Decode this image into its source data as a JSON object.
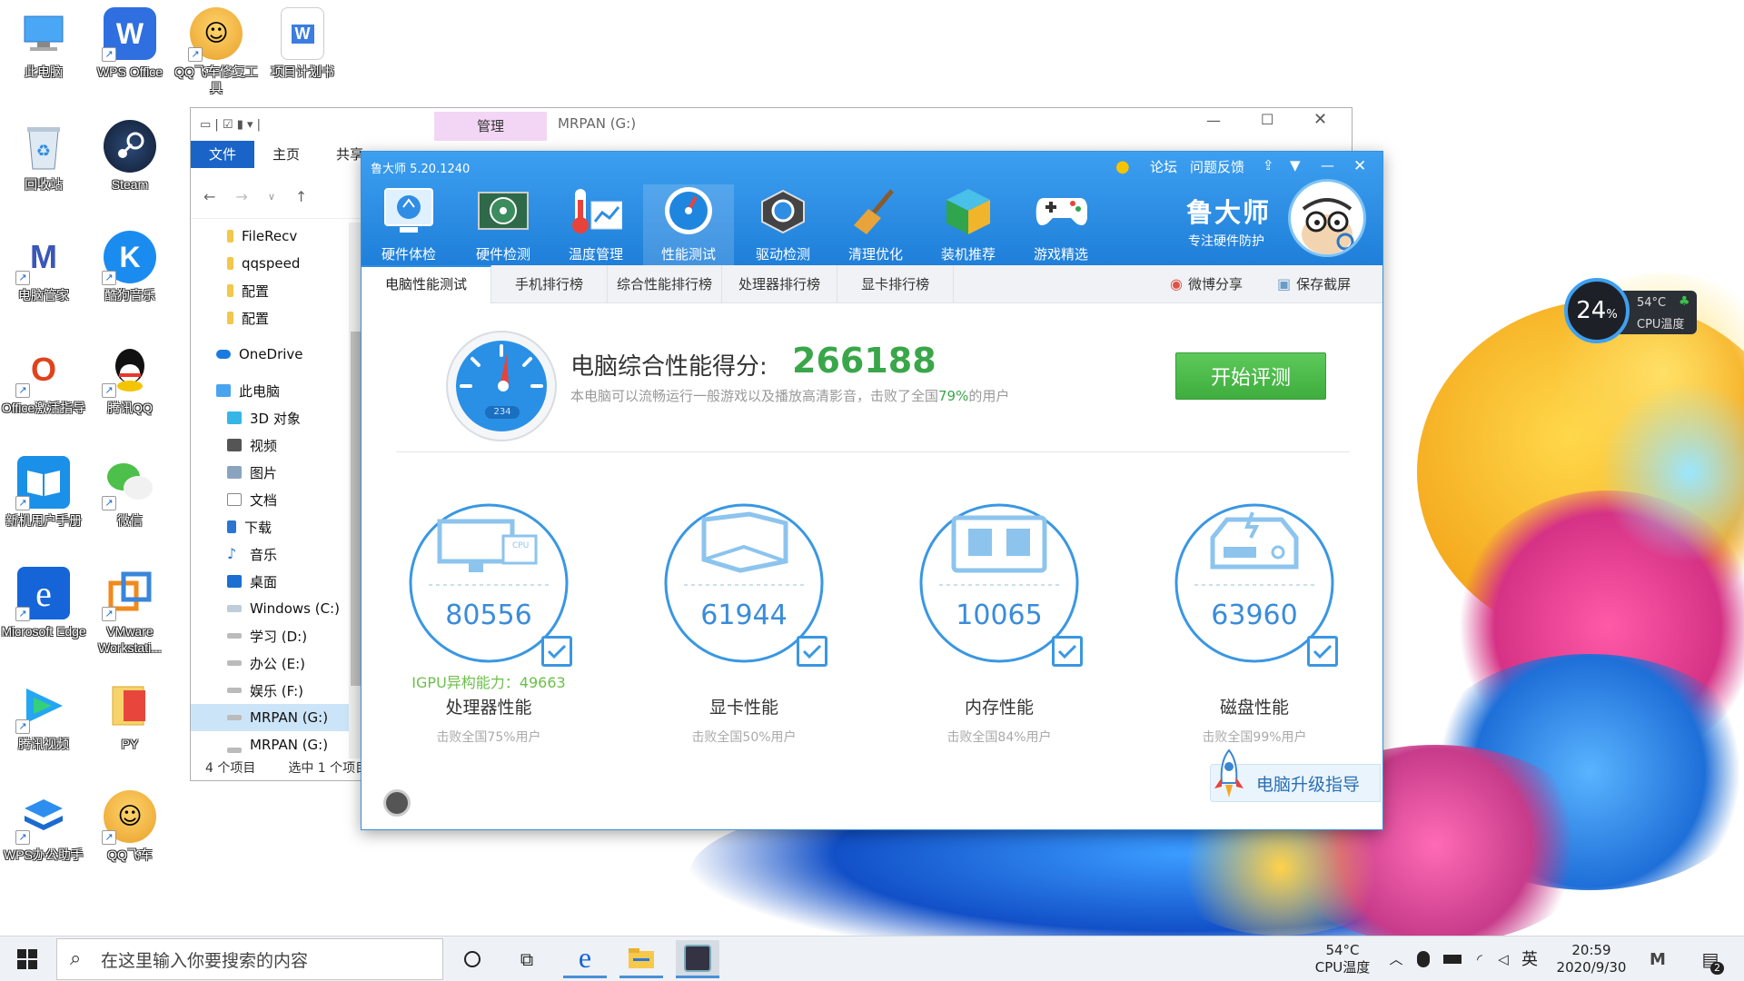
{
  "desktop": {
    "icons": [
      {
        "label": "此电脑",
        "icon": "computer-icon"
      },
      {
        "label": "WPS Office",
        "icon": "wps-icon"
      },
      {
        "label": "QQ飞车修复工具",
        "icon": "qq-speed-icon"
      },
      {
        "label": "项目计划书",
        "icon": "word-doc-icon"
      },
      {
        "label": "回收站",
        "icon": "recycle-bin-icon"
      },
      {
        "label": "Steam",
        "icon": "steam-icon"
      },
      {
        "label": "电脑管家",
        "icon": "pc-manager-icon"
      },
      {
        "label": "酷狗音乐",
        "icon": "kugou-icon"
      },
      {
        "label": "Office激活指导",
        "icon": "office-icon"
      },
      {
        "label": "腾讯QQ",
        "icon": "qq-icon"
      },
      {
        "label": "新机用户手册",
        "icon": "manual-icon"
      },
      {
        "label": "微信",
        "icon": "wechat-icon"
      },
      {
        "label": "Microsoft Edge",
        "icon": "edge-icon"
      },
      {
        "label": "VMware Workstati...",
        "icon": "vmware-icon"
      },
      {
        "label": "腾讯视频",
        "icon": "tencent-video-icon"
      },
      {
        "label": "PY",
        "icon": "folder-icon"
      },
      {
        "label": "WPS办公助手",
        "icon": "wps-assistant-icon"
      },
      {
        "label": "QQ飞车",
        "icon": "qq-speed-icon"
      }
    ]
  },
  "explorer": {
    "context_tab": "管理",
    "drive_title": "MRPAN (G:)",
    "ribbon_tabs": [
      "文件",
      "主页",
      "共享"
    ],
    "nav_items": [
      {
        "label": "FileRecv",
        "icon": "folder-icon"
      },
      {
        "label": "qqspeed",
        "icon": "folder-icon"
      },
      {
        "label": "配置",
        "icon": "folder-icon"
      },
      {
        "label": "配置",
        "icon": "folder-icon"
      },
      {
        "label": "OneDrive",
        "icon": "onedrive-icon"
      },
      {
        "label": "此电脑",
        "icon": "computer-icon"
      },
      {
        "label": "3D 对象",
        "icon": "3d-objects-icon"
      },
      {
        "label": "视频",
        "icon": "video-icon"
      },
      {
        "label": "图片",
        "icon": "picture-icon"
      },
      {
        "label": "文档",
        "icon": "document-icon"
      },
      {
        "label": "下载",
        "icon": "download-icon"
      },
      {
        "label": "音乐",
        "icon": "music-icon"
      },
      {
        "label": "桌面",
        "icon": "desktop-icon"
      },
      {
        "label": "Windows (C:)",
        "icon": "drive-icon"
      },
      {
        "label": "学习 (D:)",
        "icon": "drive-icon"
      },
      {
        "label": "办公 (E:)",
        "icon": "drive-icon"
      },
      {
        "label": "娱乐 (F:)",
        "icon": "drive-icon"
      },
      {
        "label": "MRPAN (G:)",
        "icon": "drive-icon"
      },
      {
        "label": "MRPAN (G:)",
        "icon": "drive-icon"
      }
    ],
    "status_count": "4 个项目",
    "status_selected": "选中 1 个项目"
  },
  "ludashi": {
    "app_version": "鲁大师 5.20.1240",
    "toolbar": [
      {
        "label": "硬件体检",
        "icon": "hardware-check-icon"
      },
      {
        "label": "硬件检测",
        "icon": "hardware-detect-icon"
      },
      {
        "label": "温度管理",
        "icon": "temperature-icon"
      },
      {
        "label": "性能测试",
        "icon": "performance-icon"
      },
      {
        "label": "驱动检测",
        "icon": "driver-icon"
      },
      {
        "label": "清理优化",
        "icon": "broom-icon"
      },
      {
        "label": "装机推荐",
        "icon": "cube-icon"
      },
      {
        "label": "游戏精选",
        "icon": "gamepad-icon"
      }
    ],
    "top_links": [
      "论坛",
      "问题反馈"
    ],
    "brand": "鲁大师",
    "brand_sub": "专注硬件防护",
    "subtabs": [
      "电脑性能测试",
      "手机排行榜",
      "综合性能排行榜",
      "处理器排行榜",
      "显卡排行榜"
    ],
    "share_label": "微博分享",
    "screenshot_label": "保存截屏",
    "gauge_value": "234",
    "score_label": "电脑综合性能得分:",
    "score_value": "266188",
    "score_sub_pre": "本电脑可以流畅运行一般游戏以及播放高清影音，击败了全国",
    "score_sub_pct": "79%",
    "score_sub_post": "的用户",
    "start_button": "开始评测",
    "metrics": [
      {
        "value": "80556",
        "name": "处理器性能",
        "beat": "击败全国75%用户",
        "extra": "IGPU异构能力：49663",
        "icon": "cpu-monitor-icon"
      },
      {
        "value": "61944",
        "name": "显卡性能",
        "beat": "击败全国50%用户",
        "extra": "",
        "icon": "gpu-box-icon"
      },
      {
        "value": "10065",
        "name": "内存性能",
        "beat": "击败全国84%用户",
        "extra": "",
        "icon": "memory-chip-icon"
      },
      {
        "value": "63960",
        "name": "磁盘性能",
        "beat": "击败全国99%用户",
        "extra": "",
        "icon": "disk-drive-icon"
      }
    ],
    "upgrade_label": "电脑升级指导",
    "cpu_chip_label": "CPU"
  },
  "cpu_widget": {
    "usage": "24",
    "usage_unit": "%",
    "temp": "54°C",
    "label": "CPU温度"
  },
  "taskbar": {
    "search_placeholder": "在这里输入你要搜索的内容",
    "cpu_temp": "54°C",
    "cpu_label": "CPU温度",
    "ime": "英",
    "time": "20:59",
    "date": "2020/9/30",
    "notification_count": "2"
  },
  "colors": {
    "accent": "#2e8ee6",
    "score_green": "#3aa64a",
    "button_green": "#4cbb4a",
    "circle_blue": "#3a97e3"
  }
}
